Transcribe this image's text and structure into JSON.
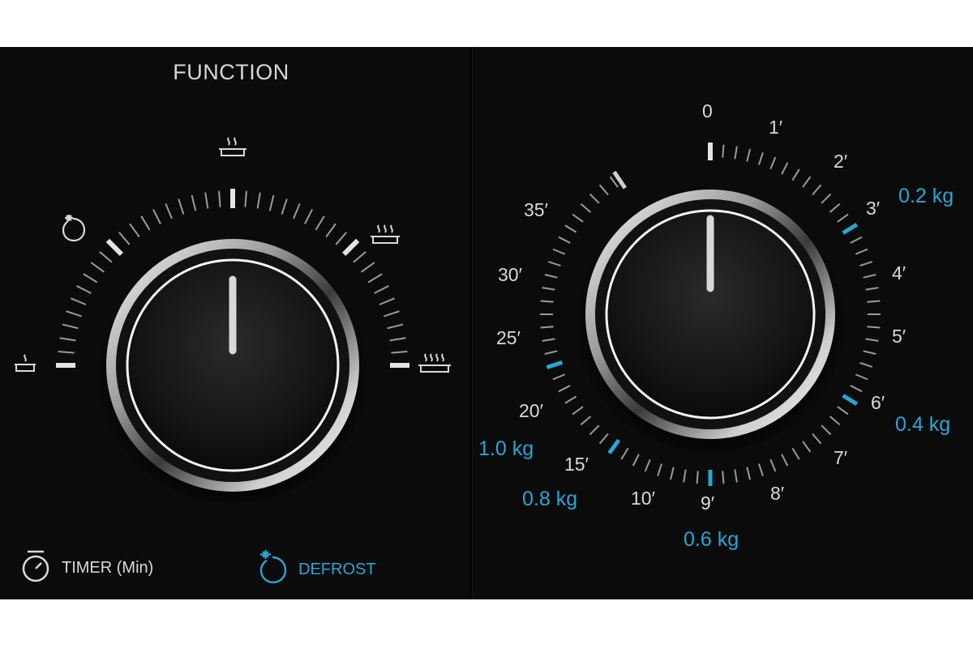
{
  "function_panel": {
    "title": "FUNCTION",
    "modes": [
      {
        "icon": "low-heat-bowl-icon"
      },
      {
        "icon": "defrost-icon"
      },
      {
        "icon": "medium-heat-bowl-icon"
      },
      {
        "icon": "high-heat-bowl-icon"
      },
      {
        "icon": "max-heat-bowl-icon"
      }
    ],
    "selected_mode": "medium-heat-bowl-icon"
  },
  "timer_panel": {
    "minute_marks": [
      "0",
      "1′",
      "2′",
      "3′",
      "4′",
      "5′",
      "6′",
      "7′",
      "8′",
      "9′",
      "10′",
      "15′",
      "20′",
      "25′",
      "30′",
      "35′"
    ],
    "defrost_weights": [
      "0.2 kg",
      "0.4 kg",
      "0.6 kg",
      "0.8 kg",
      "1.0 kg"
    ],
    "current_minutes": 0
  },
  "legend": {
    "timer_label": "TIMER (Min)",
    "timer_icon": "stopwatch-icon",
    "defrost_label": "DEFROST",
    "defrost_icon": "defrost-icon"
  },
  "colors": {
    "background": "#0b0b0c",
    "text": "#d9d9d9",
    "accent_blue": "#27a7d6",
    "knob_ring": "#ffffff"
  }
}
